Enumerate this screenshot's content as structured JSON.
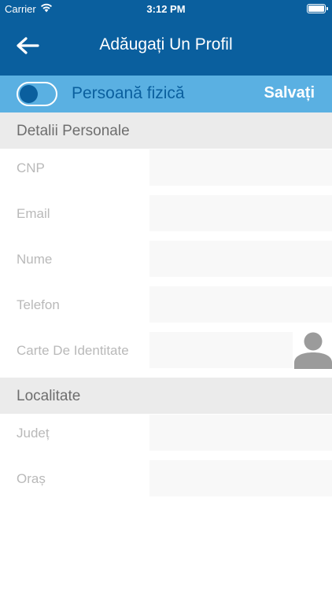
{
  "status_bar": {
    "carrier": "Carrier",
    "time": "3:12 PM"
  },
  "header": {
    "title": "Adăugați Un Profil",
    "back_icon": "arrow-left-icon"
  },
  "toolbar": {
    "toggle_label": "Persoană fizică",
    "toggle_on": false,
    "save_label": "Salvați"
  },
  "sections": {
    "personal": {
      "title": "Detalii Personale",
      "fields": [
        {
          "label": "CNP",
          "value": ""
        },
        {
          "label": "Email",
          "value": ""
        },
        {
          "label": "Nume",
          "value": ""
        },
        {
          "label": "Telefon",
          "value": ""
        },
        {
          "label": "Carte De Identitate",
          "value": ""
        }
      ]
    },
    "location": {
      "title": "Localitate",
      "fields": [
        {
          "label": "Județ",
          "value": ""
        },
        {
          "label": "Oraș",
          "value": ""
        }
      ]
    }
  },
  "colors": {
    "header": "#0a5f9e",
    "toolbar": "#5ab0e2",
    "section": "#ebebeb",
    "label_text": "#b9b9b9"
  }
}
